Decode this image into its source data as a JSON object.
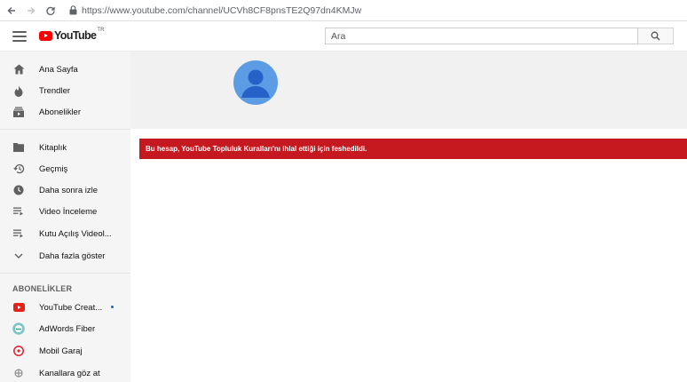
{
  "browser": {
    "url": "https://www.youtube.com/channel/UCVh8CF8pnsTE2Q97dn4KMJw"
  },
  "masthead": {
    "logo_text": "YouTube",
    "logo_country": "TR",
    "search_placeholder": "Ara"
  },
  "sidebar": {
    "main_items": [
      {
        "label": "Ana Sayfa",
        "icon": "home-icon"
      },
      {
        "label": "Trendler",
        "icon": "trending-icon"
      },
      {
        "label": "Abonelikler",
        "icon": "subscriptions-icon"
      }
    ],
    "library_items": [
      {
        "label": "Kitaplık",
        "icon": "library-icon"
      },
      {
        "label": "Geçmiş",
        "icon": "history-icon"
      },
      {
        "label": "Daha sonra izle",
        "icon": "watch-later-icon"
      },
      {
        "label": "Video İnceleme",
        "icon": "playlist-icon"
      },
      {
        "label": "Kutu Açılış Videol...",
        "icon": "playlist-icon"
      },
      {
        "label": "Daha fazla göster",
        "icon": "chevron-down-icon"
      }
    ],
    "subscriptions_title": "ABONELİKLER",
    "subscriptions": [
      {
        "label": "YouTube Creat...",
        "icon": "youtube-creators-icon",
        "new": true
      },
      {
        "label": "AdWords Fiber",
        "icon": "adwords-fiber-icon"
      },
      {
        "label": "Mobil Garaj",
        "icon": "mobil-garaj-icon"
      },
      {
        "label": "Kanallara göz at",
        "icon": "browse-channels-icon"
      }
    ]
  },
  "main": {
    "alert_text": "Bu hesap, YouTube Topluluk Kuralları'nı ihlal ettiği için feshedildi."
  },
  "colors": {
    "brand_red": "#ff0000",
    "alert_red": "#c6181f",
    "avatar_blue": "#5c9ce4",
    "sidebar_bg": "#f5f5f5"
  }
}
